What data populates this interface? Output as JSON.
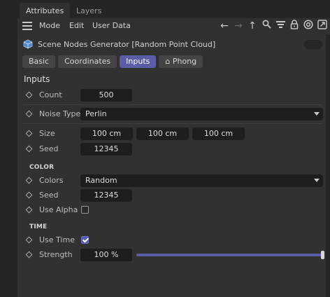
{
  "tabs": [
    {
      "label": "Attributes"
    },
    {
      "label": "Layers"
    }
  ],
  "menu": {
    "items": [
      {
        "label": "Mode"
      },
      {
        "label": "Edit"
      },
      {
        "label": "User Data"
      }
    ],
    "icons": [
      "arrow-left-icon",
      "arrow-right-icon",
      "arrow-up-icon",
      "search-icon",
      "filter-icon",
      "lock-icon",
      "target-icon",
      "expand-icon"
    ]
  },
  "object": {
    "title": "Scene Nodes Generator [Random Point Cloud]",
    "icon": "cube-icon"
  },
  "subtabs": [
    {
      "label": "Basic"
    },
    {
      "label": "Coordinates"
    },
    {
      "label": "Inputs",
      "active": true
    },
    {
      "label": "⌂ Phong"
    }
  ],
  "section": {
    "title": "Inputs"
  },
  "params": {
    "count": {
      "label": "Count",
      "value": "500"
    },
    "noise_type": {
      "label": "Noise Type",
      "value": "Perlin"
    },
    "size": {
      "label": "Size",
      "x": "100 cm",
      "y": "100 cm",
      "z": "100 cm"
    },
    "seed": {
      "label": "Seed",
      "value": "12345"
    }
  },
  "color_group": {
    "title": "COLOR",
    "colors": {
      "label": "Colors",
      "value": "Random"
    },
    "seed": {
      "label": "Seed",
      "value": "12345"
    },
    "use_alpha": {
      "label": "Use Alpha",
      "checked": false
    }
  },
  "time_group": {
    "title": "TIME",
    "use_time": {
      "label": "Use Time",
      "checked": true
    },
    "strength": {
      "label": "Strength",
      "value": "100 %",
      "level": 1.0
    }
  },
  "accent_color": "#5a5da3"
}
